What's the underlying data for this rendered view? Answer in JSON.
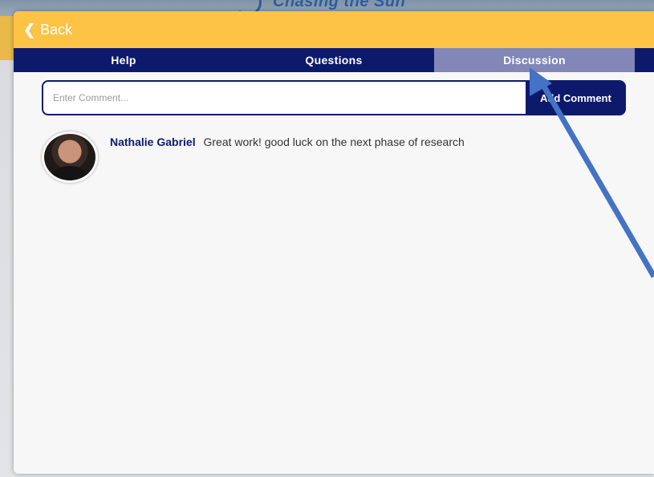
{
  "background": {
    "title": "Chasing the Sun"
  },
  "header": {
    "back_label": "Back",
    "back_icon": "chevron-left-icon",
    "color": "#fcc344"
  },
  "tabs": [
    {
      "label": "Help",
      "active": false
    },
    {
      "label": "Questions",
      "active": false
    },
    {
      "label": "Discussion",
      "active": true
    }
  ],
  "colors": {
    "nav": "#0d1a6b",
    "active_tab": "#8287b8",
    "arrow": "#4472c4"
  },
  "comment_form": {
    "placeholder": "Enter Comment...",
    "value": "",
    "button_label": "Add Comment"
  },
  "comments": [
    {
      "author": "Nathalie Gabriel",
      "text": "Great work! good luck on the next phase of research"
    }
  ]
}
